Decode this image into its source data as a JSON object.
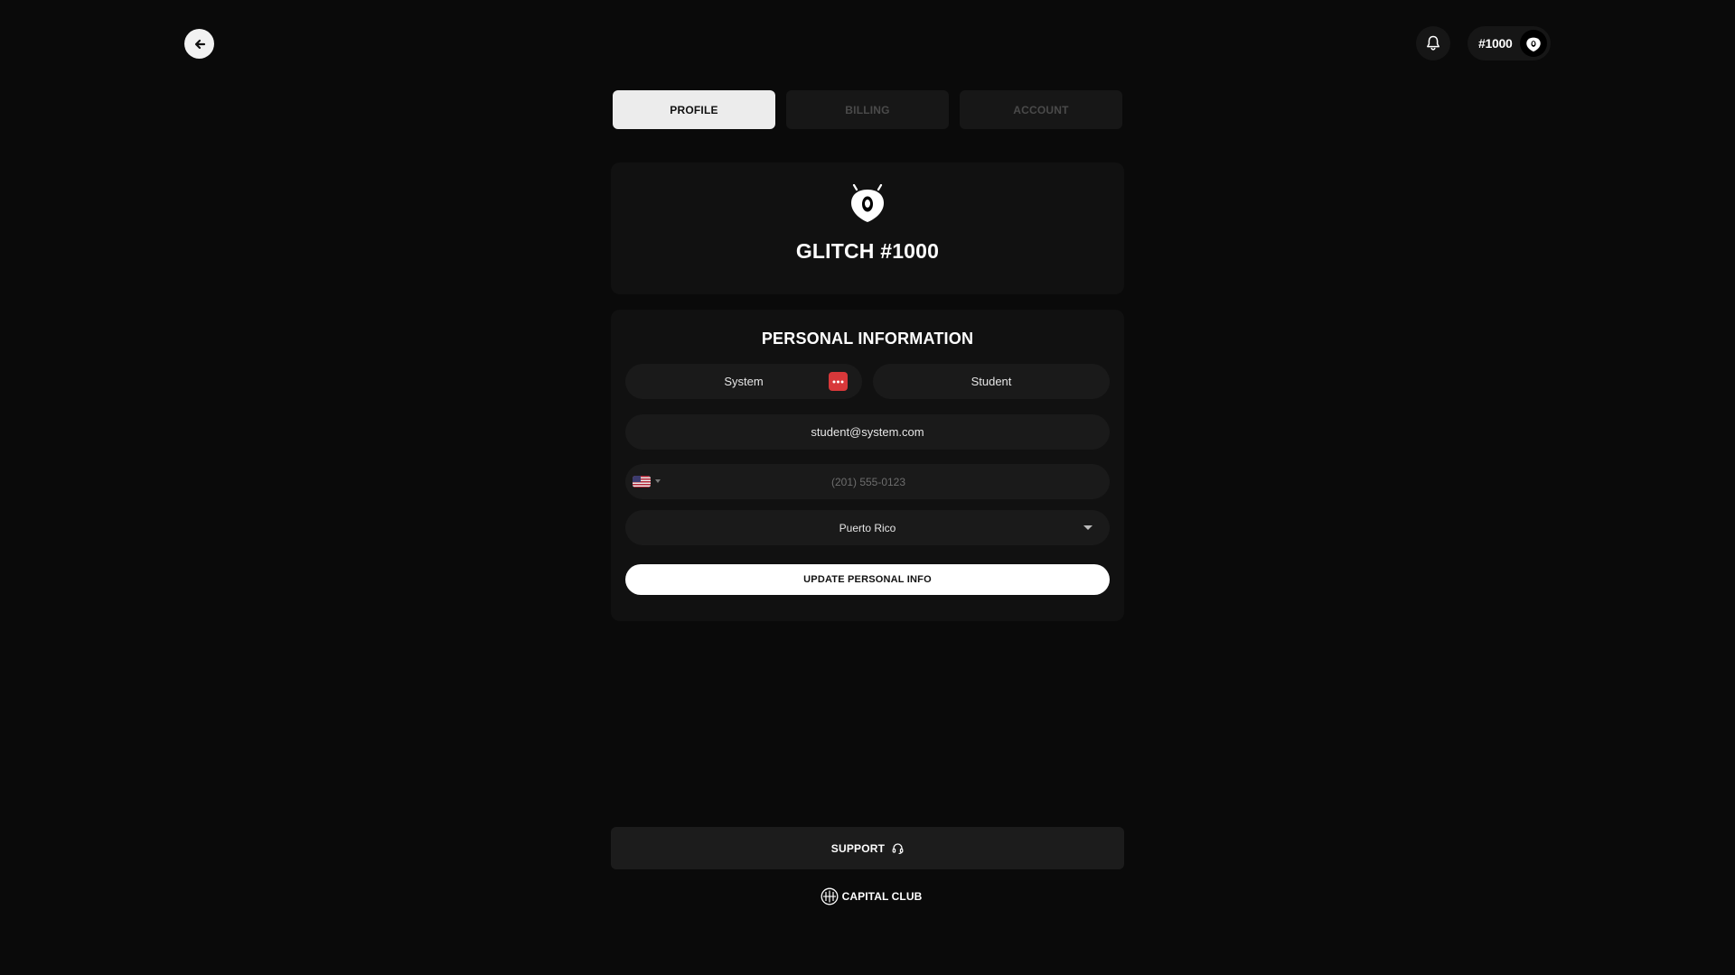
{
  "header": {
    "back_icon": "arrow-left-icon",
    "bell_icon": "bell-icon",
    "user_number": "#1000",
    "avatar_icon": "glitch-mascot-icon"
  },
  "tabs": [
    {
      "label": "PROFILE",
      "active": true
    },
    {
      "label": "BILLING",
      "active": false
    },
    {
      "label": "ACCOUNT",
      "active": false
    }
  ],
  "profile": {
    "logo_icon": "glitch-mascot-icon",
    "name": "GLITCH #1000"
  },
  "personal_info": {
    "title": "PERSONAL INFORMATION",
    "first_name": "System",
    "last_name": "Student",
    "email": "student@system.com",
    "phone_country": "US",
    "phone_placeholder": "(201) 555-0123",
    "country": "Puerto Rico",
    "submit_label": "UPDATE PERSONAL INFO"
  },
  "footer": {
    "support_label": "SUPPORT",
    "support_icon": "headset-icon",
    "brand_label": "CAPITAL CLUB",
    "brand_icon": "capital-club-logo-icon"
  },
  "colors": {
    "background": "#0a0a0a",
    "card": "#111111",
    "field": "#1a1a1a",
    "password_badge": "#d8383a",
    "active_tab": "#ececec"
  }
}
